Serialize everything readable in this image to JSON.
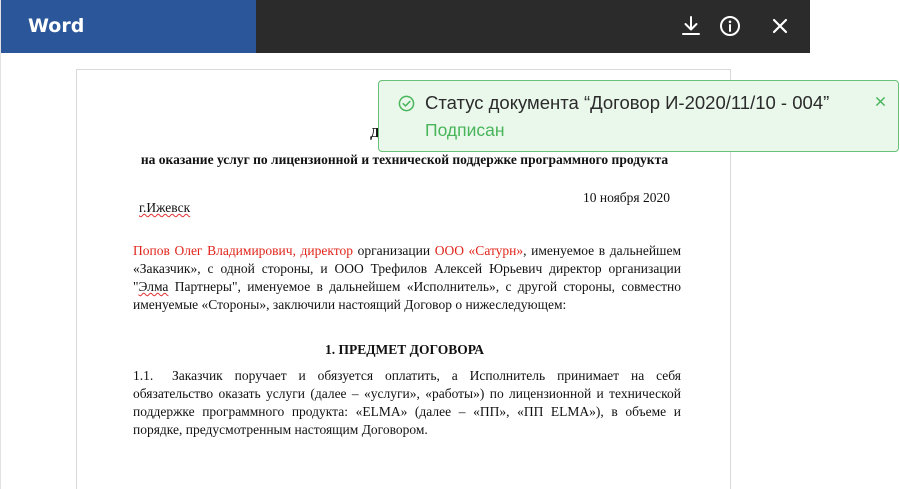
{
  "app": {
    "name": "Word"
  },
  "toolbar": {
    "icons": [
      "download-icon",
      "info-icon",
      "close-icon"
    ]
  },
  "document": {
    "title": "ДОГОВОР",
    "subtitle": "на оказание услуг по лицензионной и технической поддержке программного продукта",
    "city": "г.Ижевск",
    "date": "10 ноября 2020",
    "intro": {
      "client_person": "Попов Олег Владимирович, директор",
      "org_prefix": " организации ",
      "client_org": "ООО «Сатурн»",
      "text_1": ", именуемое в дальнейшем «Заказчик», с одной стороны, и ООО Трефилов Алексей Юрьевич директор организации \"",
      "partner_spell": "Элма",
      "text_2": " Партнеры\", именуемое в дальнейшем «Исполнитель», с другой стороны, совместно именуемые «Стороны», заключили настоящий Договор о нижеследующем:"
    },
    "section_1_title": "1. ПРЕДМЕТ ДОГОВОРА",
    "clause_1_1": {
      "number": "1.1.",
      "text": "Заказчик поручает и обязуется оплатить, а Исполнитель принимает на себя обязательство оказать услуги (далее – «услуги», «работы») по лицензионной и технической поддержке программного продукта: «ELMA» (далее – «ПП», «ПП ELMA»), в объеме и порядке, предусмотренным настоящим Договором."
    }
  },
  "notification": {
    "title": "Статус документа “Договор И-2020/11/10 - 004”",
    "status": "Подписан",
    "icons": [
      "check-circle-icon",
      "close-icon"
    ]
  },
  "colors": {
    "brand": "#2b579a",
    "topbar": "#2b2b2b",
    "success": "#49b55a",
    "success_bg": "#eaf8ec",
    "highlight_red": "#e1251b"
  }
}
